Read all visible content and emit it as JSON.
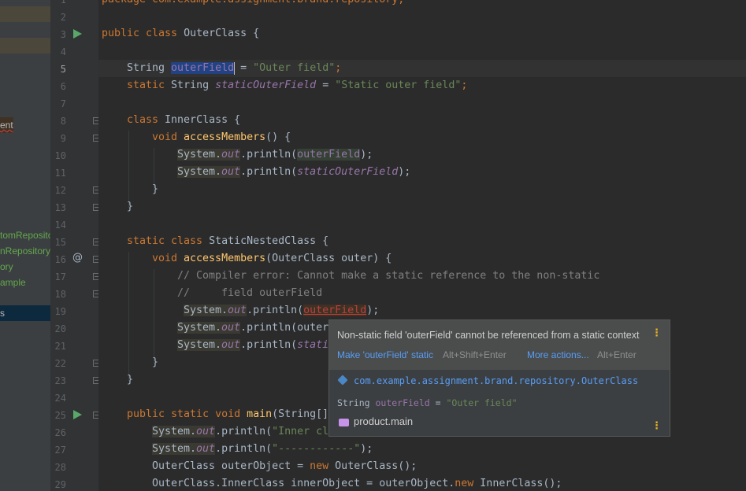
{
  "sidebar": {
    "items": [
      {
        "label": "ent",
        "state": "error"
      },
      {
        "label": "tomRepository",
        "state": "normal"
      },
      {
        "label": "nRepository",
        "state": "normal"
      },
      {
        "label": "ory",
        "state": "normal"
      },
      {
        "label": "ample",
        "state": "normal"
      },
      {
        "label": "s",
        "state": "selected"
      }
    ]
  },
  "gutter": {
    "line_numbers": [
      "1",
      "2",
      "3",
      "4",
      "5",
      "6",
      "7",
      "8",
      "9",
      "10",
      "11",
      "12",
      "13",
      "14",
      "15",
      "16",
      "17",
      "18",
      "19",
      "20",
      "21",
      "22",
      "23",
      "24",
      "25",
      "26",
      "27",
      "28",
      "29"
    ],
    "current_line": "5"
  },
  "code": {
    "line1": "package com.example.assignment.brand.repository;",
    "line3_kw": "public class",
    "line3_name": " OuterClass {",
    "line5_type": "String ",
    "line5_field": "outerField",
    "line5_eq": " = ",
    "line5_str": "\"Outer field\"",
    "line5_semi": ";",
    "line6_kw": "static",
    "line6_type": " String ",
    "line6_field": "staticOuterField",
    "line6_eq": " = ",
    "line6_str": "\"Static outer field\"",
    "line6_semi": ";",
    "line8_kw": "class",
    "line8_rest": " InnerClass {",
    "line9_kw": "void ",
    "line9_meth": "accessMembers",
    "line9_rest": "() {",
    "line10_sys": "System.",
    "line10_out": "out",
    "line10_print": ".println(",
    "line10_arg": "outerField",
    "line10_end": ");",
    "line11_sys": "System.",
    "line11_out": "out",
    "line11_print": ".println(",
    "line11_arg": "staticOuterField",
    "line11_end": ");",
    "line12": "}",
    "line13": "}",
    "line15_kw": "static class",
    "line15_rest": " StaticNestedClass {",
    "line16_kw": "void ",
    "line16_meth": "accessMembers",
    "line16_rest": "(OuterClass outer) {",
    "line17": "// Compiler error: Cannot make a static reference to the non-static",
    "line18": "//     field outerField",
    "line19_sys": "System.",
    "line19_out": "out",
    "line19_print": ".println(",
    "line19_arg": "outerField",
    "line19_end": ");",
    "line20_sys": "System.",
    "line20_out": "out",
    "line20_print": ".println(outer",
    "line21_sys": "System.",
    "line21_out": "out",
    "line21_print": ".println(",
    "line21_arg": "stati",
    "line22": "}",
    "line23": "}",
    "line25_kw": "public static void ",
    "line25_meth": "main",
    "line25_rest": "(String[]",
    "line26_sys": "System.",
    "line26_out": "out",
    "line26_print": ".println(",
    "line26_str": "\"Inner cl",
    "line27_sys": "System.",
    "line27_out": "out",
    "line27_print": ".println(",
    "line27_str": "\"------------\"",
    "line27_end": ");",
    "line28_a": "OuterClass outerObject = ",
    "line28_kw": "new",
    "line28_b": " OuterClass();",
    "line29_a": "OuterClass.InnerClass innerObject = outerObject.",
    "line29_kw": "new",
    "line29_b": " InnerClass();"
  },
  "popup": {
    "message": "Non-static field 'outerField' cannot be referenced from a static context",
    "fix_action": "Make 'outerField' static",
    "fix_shortcut": "Alt+Shift+Enter",
    "more_action": "More actions...",
    "more_shortcut": "Alt+Enter",
    "class_path": "com.example.assignment.brand.repository.OuterClass",
    "decl_type": "String ",
    "decl_field": "outerField",
    "decl_eq": " = ",
    "decl_value": "\"Outer field\"",
    "module": "product.main",
    "kebab": "⋮"
  },
  "colors": {
    "background": "#2b2b2b",
    "keyword": "#cc7832",
    "string": "#6a8759",
    "field": "#9876aa",
    "method": "#ffc66d",
    "link": "#589df6",
    "run_icon": "#59a869"
  }
}
